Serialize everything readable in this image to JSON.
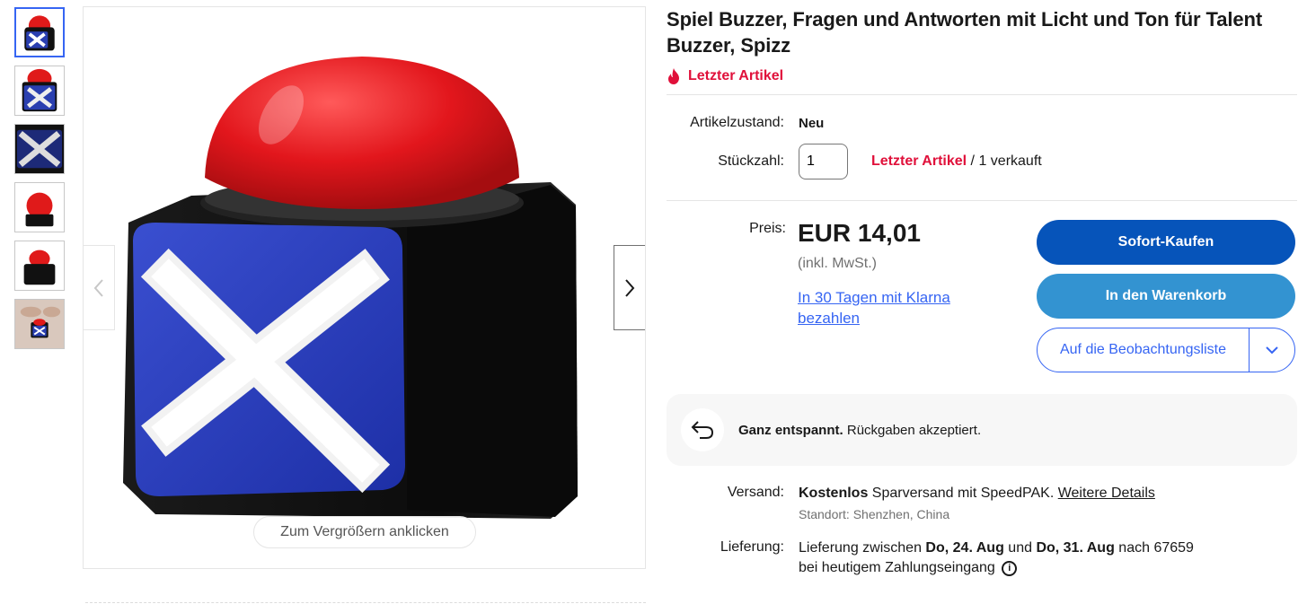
{
  "product": {
    "title": "Spiel Buzzer, Fragen und Antworten mit Licht und Ton für Talent Buzzer, Spizz",
    "badge": "Letzter Artikel",
    "badge_icon": "flame-icon"
  },
  "gallery": {
    "zoom_hint": "Zum Vergrößern anklicken",
    "thumbnail_count": 6,
    "active_index": 0
  },
  "details": {
    "condition_label": "Artikelzustand:",
    "condition_value": "Neu",
    "quantity_label": "Stückzahl:",
    "quantity_value": "1",
    "stock_red": "Letzter Artikel",
    "stock_sold": " / 1 verkauft"
  },
  "pricing": {
    "label": "Preis:",
    "price": "EUR 14,01",
    "vat_note": "(inkl. MwSt.)",
    "klarna_link": "In 30 Tagen mit Klarna bezahlen"
  },
  "actions": {
    "buy_now": "Sofort-Kaufen",
    "add_to_cart": "In den Warenkorb",
    "watchlist": "Auf die Beobachtungsliste"
  },
  "returns": {
    "bold": "Ganz entspannt.",
    "text": " Rückgaben akzeptiert."
  },
  "shipping": {
    "label": "Versand:",
    "bold": "Kostenlos",
    "method": " Sparversand mit SpeedPAK. ",
    "details_link": "Weitere Details",
    "location": "Standort: Shenzhen, China"
  },
  "delivery": {
    "label": "Lieferung:",
    "text_1": "Lieferung zwischen ",
    "date_from": "Do, 24. Aug",
    "text_2": " und ",
    "date_to": "Do, 31. Aug",
    "text_3": " nach 67659",
    "text_4": "bei heutigem Zahlungseingang"
  },
  "colors": {
    "buy_button": "#0654ba",
    "cart_button": "#3393d1",
    "link_blue": "#3665f3",
    "alert_red": "#e0103a"
  }
}
